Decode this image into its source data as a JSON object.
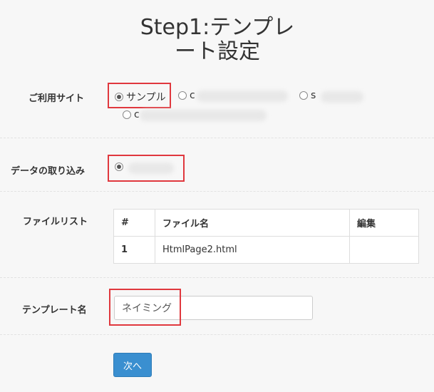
{
  "page": {
    "title_line1": "Step1:テンプレ",
    "title_line2": "ート設定"
  },
  "site": {
    "label": "ご利用サイト",
    "options": [
      {
        "label": "サンプル",
        "checked": true
      },
      {
        "label": "c",
        "checked": false
      },
      {
        "label": "s",
        "checked": false
      },
      {
        "label": "c",
        "checked": false
      }
    ]
  },
  "import": {
    "label": "データの取り込み",
    "options": [
      {
        "label": "",
        "checked": true
      }
    ]
  },
  "file_list": {
    "label": "ファイルリスト",
    "columns": [
      "#",
      "ファイル名",
      "編集"
    ],
    "rows": [
      {
        "num": "1",
        "name": "HtmlPage2.html",
        "edit": ""
      }
    ]
  },
  "template_name": {
    "label": "テンプレート名",
    "value": "ネイミング"
  },
  "next_button": {
    "label": "次へ"
  },
  "colors": {
    "highlight": "#e0383e",
    "button": "#3a8fd0"
  }
}
